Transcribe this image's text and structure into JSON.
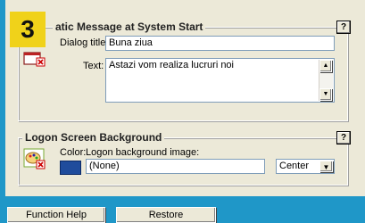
{
  "step_badge": "3",
  "message_group": {
    "title": "atic Message at System Start",
    "help": "?",
    "dialog_title_label": "Dialog title:",
    "dialog_title_value": "Buna ziua",
    "text_label": "Text:",
    "text_value": "Astazi vom realiza lucruri noi"
  },
  "logon_group": {
    "title": "Logon Screen Background",
    "help": "?",
    "color_label": "Color:",
    "image_label": "Logon background image:",
    "image_value": "(None)",
    "position_value": "Center",
    "swatch_color": "#1f4c9c"
  },
  "buttons": {
    "function_help": "Function Help",
    "restore": "Restore"
  }
}
